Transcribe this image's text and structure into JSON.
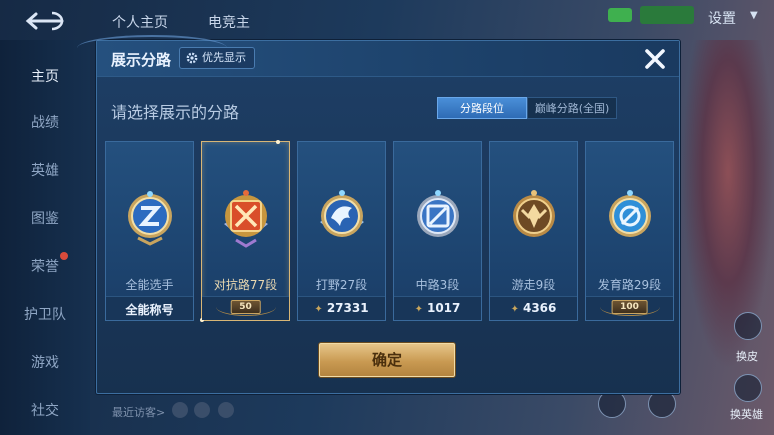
{
  "background": {
    "top_tabs": [
      "个人主页",
      "电竞主"
    ],
    "settings_label": "设置",
    "sidebar": [
      {
        "label": "主页",
        "active": true
      },
      {
        "label": "战绩"
      },
      {
        "label": "英雄"
      },
      {
        "label": "图鉴"
      },
      {
        "label": "荣誉",
        "badge": true
      },
      {
        "label": "护卫队"
      },
      {
        "label": "游戏"
      },
      {
        "label": "社交"
      }
    ],
    "recent_visitors": "最近访客>",
    "right_labels": [
      "换皮",
      "换英雄"
    ]
  },
  "dialog": {
    "title": "展示分路",
    "priority_button": "优先显示",
    "subtitle": "请选择展示的分路",
    "segments": [
      {
        "label": "分路段位",
        "active": true
      },
      {
        "label": "巅峰分路(全国)",
        "active": false
      }
    ],
    "cards": [
      {
        "name": "全能选手",
        "stat": "全能称号",
        "emblem": "allround-emblem-icon",
        "stat_type": "text"
      },
      {
        "name": "对抗路77段",
        "stat": "50",
        "emblem": "clash-lane-emblem-icon",
        "stat_type": "plaque",
        "selected": true
      },
      {
        "name": "打野27段",
        "stat": "27331",
        "emblem": "jungle-emblem-icon",
        "stat_type": "score"
      },
      {
        "name": "中路3段",
        "stat": "1017",
        "emblem": "mid-lane-emblem-icon",
        "stat_type": "score"
      },
      {
        "name": "游走9段",
        "stat": "4366",
        "emblem": "roam-emblem-icon",
        "stat_type": "score"
      },
      {
        "name": "发育路29段",
        "stat": "100",
        "emblem": "farm-lane-emblem-icon",
        "stat_type": "plaque"
      }
    ],
    "confirm_label": "确定"
  },
  "colors": {
    "accent_gold": "#d8b676",
    "segment_active": "#2e6bb5",
    "dialog_bg": "#1e3f66"
  }
}
